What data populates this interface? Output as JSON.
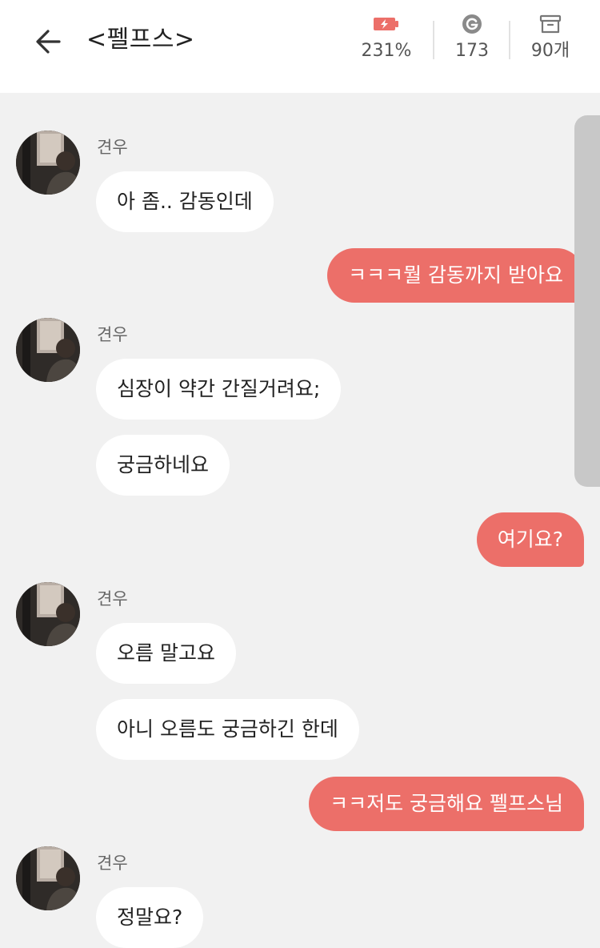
{
  "header": {
    "title": "<펠프스>",
    "stats": {
      "battery": "231%",
      "coins": "173",
      "items": "90개"
    }
  },
  "chat": {
    "sender_name": "견우",
    "groups": [
      {
        "sender": "견우",
        "messages": [
          "아 좀.. 감동인데"
        ]
      },
      {
        "reply": "ㅋㅋㅋ뭘 감동까지 받아요"
      },
      {
        "sender": "견우",
        "messages": [
          "심장이 약간 간질거려요;",
          "궁금하네요"
        ]
      },
      {
        "reply": "여기요?"
      },
      {
        "sender": "견우",
        "messages": [
          "오름 말고요",
          "아니 오름도 궁금하긴 한데"
        ]
      },
      {
        "reply": "ㅋㅋ저도 궁금해요 펠프스님"
      },
      {
        "sender": "견우",
        "messages": [
          "정말요?"
        ]
      }
    ]
  },
  "colors": {
    "accent": "#ec6f69",
    "background": "#f1f1f1",
    "incoming_bubble": "#ffffff"
  },
  "icons": {
    "back": "arrow-left-icon",
    "battery": "battery-charging-icon",
    "coin": "g-coin-icon",
    "box": "storage-box-icon"
  }
}
